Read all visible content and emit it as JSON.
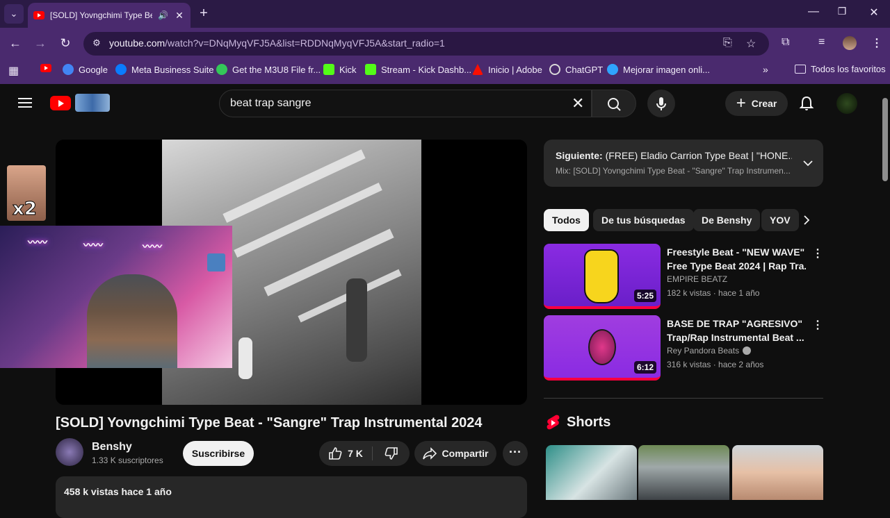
{
  "browser": {
    "tab": {
      "title": "[SOLD] Yovngchimi Type Beat"
    },
    "url": {
      "host": "youtube.com",
      "path": "/watch?v=DNqMyqVFJ5A&list=RDDNqMyqVFJ5A&start_radio=1"
    },
    "bookmarks": [
      {
        "label": "Google",
        "color": "#4285f4"
      },
      {
        "label": "Meta Business Suite",
        "color": "#0a7cff"
      },
      {
        "label": "Get the M3U8 File fr...",
        "color": "#34c759"
      },
      {
        "label": "Kick",
        "color": "#53fc18"
      },
      {
        "label": "Stream - Kick Dashb...",
        "color": "#53fc18"
      },
      {
        "label": "Inicio | Adobe",
        "color": "#fa0f00"
      },
      {
        "label": "ChatGPT",
        "color": "#d9d9d9"
      },
      {
        "label": "Mejorar imagen onli...",
        "color": "#2fa4ff"
      }
    ],
    "all_bookmarks": "Todos los favoritos"
  },
  "youtube": {
    "search_value": "beat trap sangre",
    "create_label": "Crear",
    "video": {
      "title": "[SOLD] Yovngchimi Type Beat - \"Sangre\" Trap Instrumental 2024",
      "channel": "Benshy",
      "subscribers": "1.33 K suscriptores",
      "subscribe_label": "Suscribirse",
      "likes": "7 K",
      "share_label": "Compartir",
      "views_line": "458 k vistas  hace 1 año",
      "overlay_badge": "x2"
    },
    "up_next": {
      "title_prefix": "Siguiente:",
      "title": "(FREE) Eladio Carrion Type Beat | \"HONE...",
      "subtitle": "Mix: [SOLD] Yovngchimi Type Beat - \"Sangre\" Trap Instrumen..."
    },
    "chips": [
      "Todos",
      "De tus búsquedas",
      "De Benshy",
      "YOV"
    ],
    "recommendations": [
      {
        "title_line1": "Freestyle Beat  - \"NEW WAVE\" |",
        "title_line2": "Free Type Beat 2024 | Rap Tra...",
        "channel": "EMPIRE BEATZ",
        "meta": "182 k vistas · hace 1 año",
        "duration": "5:25",
        "verified": false
      },
      {
        "title_line1": "BASE DE TRAP \"AGRESIVO\"",
        "title_line2": "Trap/Rap Instrumental Beat ...",
        "channel": "Rey Pandora Beats",
        "meta": "316 k vistas · hace 2 años",
        "duration": "6:12",
        "verified": true
      }
    ],
    "shorts_title": "Shorts",
    "accent": "#ff0000"
  }
}
